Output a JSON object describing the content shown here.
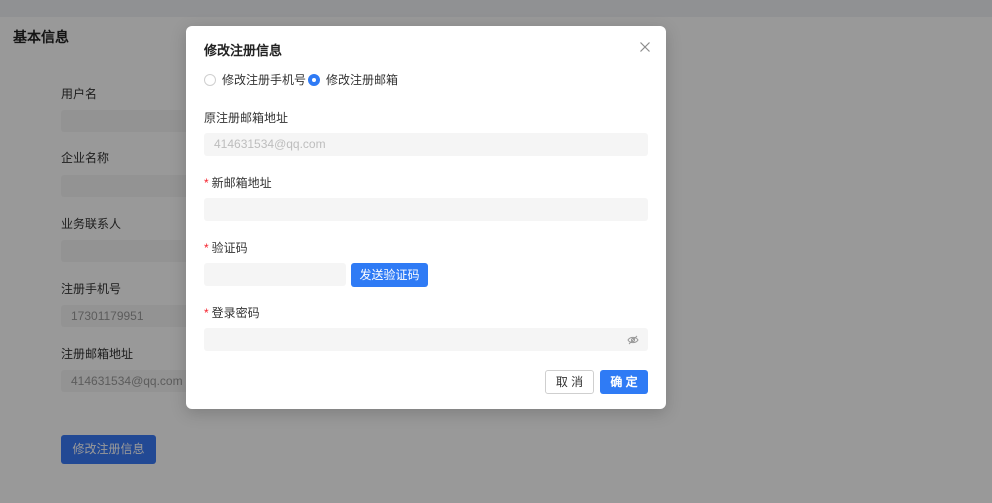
{
  "page": {
    "title": "基本信息",
    "fields": [
      {
        "label": "用户名"
      },
      {
        "label": "企业名称"
      },
      {
        "label": "业务联系人"
      },
      {
        "label": "注册手机号",
        "value": "17301179951"
      },
      {
        "label": "注册邮箱地址",
        "value": "414631534@qq.com"
      }
    ],
    "edit_button": "修改注册信息"
  },
  "modal": {
    "title": "修改注册信息",
    "radios": [
      {
        "label": "修改注册手机号",
        "checked": false
      },
      {
        "label": "修改注册邮箱",
        "checked": true
      }
    ],
    "original_email": {
      "label": "原注册邮箱地址",
      "value": "414631534@qq.com"
    },
    "new_email": {
      "required_mark": "*",
      "label": "新邮箱地址"
    },
    "code": {
      "required_mark": "*",
      "label": "验证码",
      "send_button": "发送验证码"
    },
    "password": {
      "required_mark": "*",
      "label": "登录密码"
    },
    "cancel_button": "取 消",
    "confirm_button": "确 定"
  },
  "icons": {
    "close": "close-icon",
    "password_toggle": "eye-off-icon"
  },
  "colors": {
    "accent": "#2f7bf5",
    "required": "#f5222d",
    "overlay": "rgba(0,0,0,0.4)"
  }
}
